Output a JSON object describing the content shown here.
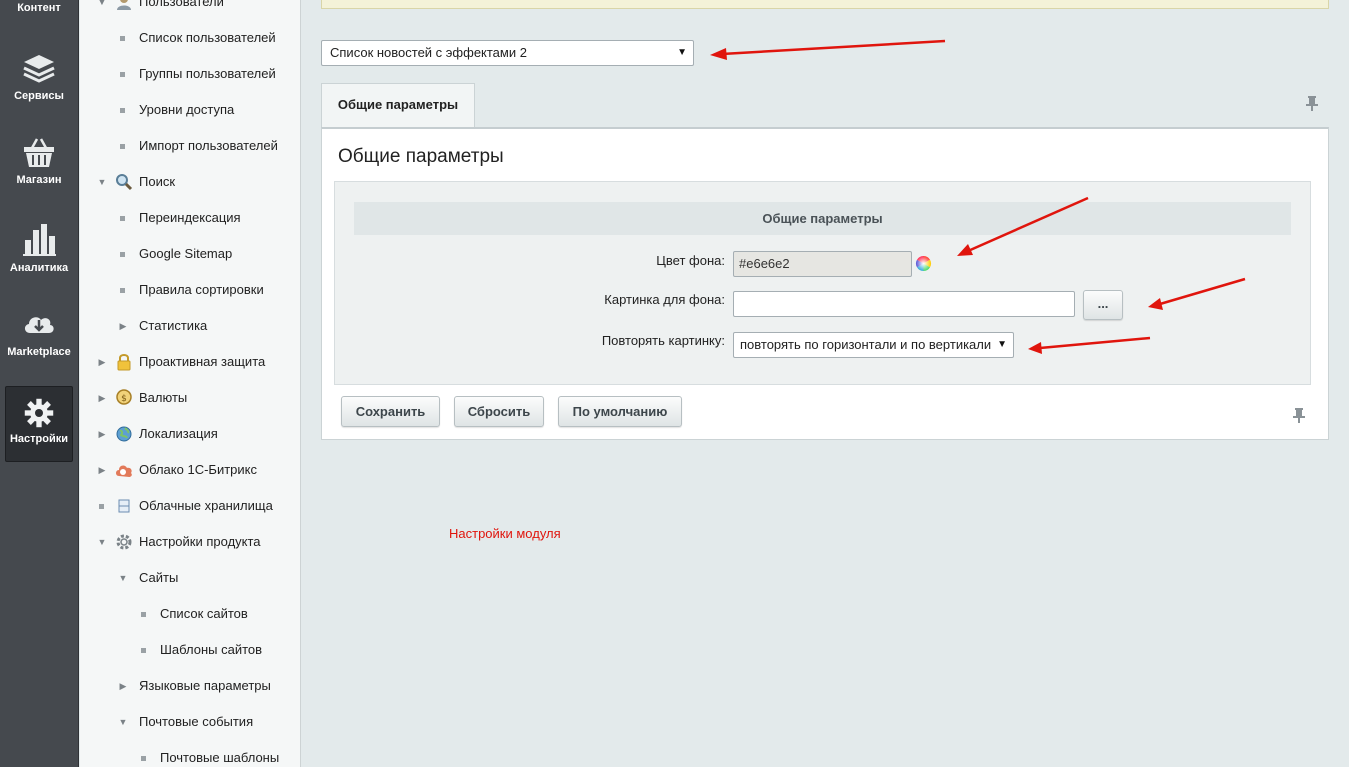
{
  "leftbar": {
    "items": [
      {
        "label": "Контент",
        "icon": "content-icon"
      },
      {
        "label": "Сервисы",
        "icon": "layers-icon"
      },
      {
        "label": "Магазин",
        "icon": "basket-icon"
      },
      {
        "label": "Аналитика",
        "icon": "bar-chart-icon"
      },
      {
        "label": "Marketplace",
        "icon": "cloud-download-icon"
      },
      {
        "label": "Настройки",
        "icon": "gear-icon"
      }
    ]
  },
  "menu": {
    "items": [
      {
        "label": "Пользователи"
      },
      {
        "label": "Список пользователей"
      },
      {
        "label": "Группы пользователей"
      },
      {
        "label": "Уровни доступа"
      },
      {
        "label": "Импорт пользователей"
      },
      {
        "label": "Поиск"
      },
      {
        "label": "Переиндексация"
      },
      {
        "label": "Google Sitemap"
      },
      {
        "label": "Правила сортировки"
      },
      {
        "label": "Статистика"
      },
      {
        "label": "Проактивная защита"
      },
      {
        "label": "Валюты"
      },
      {
        "label": "Локализация"
      },
      {
        "label": "Облако 1С-Битрикс"
      },
      {
        "label": "Облачные хранилища"
      },
      {
        "label": "Настройки продукта"
      },
      {
        "label": "Сайты"
      },
      {
        "label": "Список сайтов"
      },
      {
        "label": "Шаблоны сайтов"
      },
      {
        "label": "Языковые параметры"
      },
      {
        "label": "Почтовые события"
      },
      {
        "label": "Почтовые шаблоны"
      }
    ]
  },
  "module_select": {
    "value": "Список новостей с эффектами 2"
  },
  "tabs": [
    {
      "label": "Общие параметры"
    }
  ],
  "panel": {
    "title": "Общие параметры",
    "section_head": "Общие параметры",
    "fields": {
      "bg_color": {
        "label": "Цвет фона:",
        "value": "#e6e6e2"
      },
      "bg_image": {
        "label": "Картинка для фона:",
        "value": "",
        "browse_label": "..."
      },
      "repeat": {
        "label": "Повторять картинку:",
        "value": "повторять по горизонтали и по вертикали"
      }
    },
    "buttons": {
      "save": "Сохранить",
      "reset": "Сбросить",
      "default": "По умолчанию"
    }
  },
  "footer_note": "Настройки модуля",
  "colors": {
    "accent_red": "#e0150d",
    "sidebar_bg": "#45494e",
    "bg": "#e3eaeb"
  }
}
